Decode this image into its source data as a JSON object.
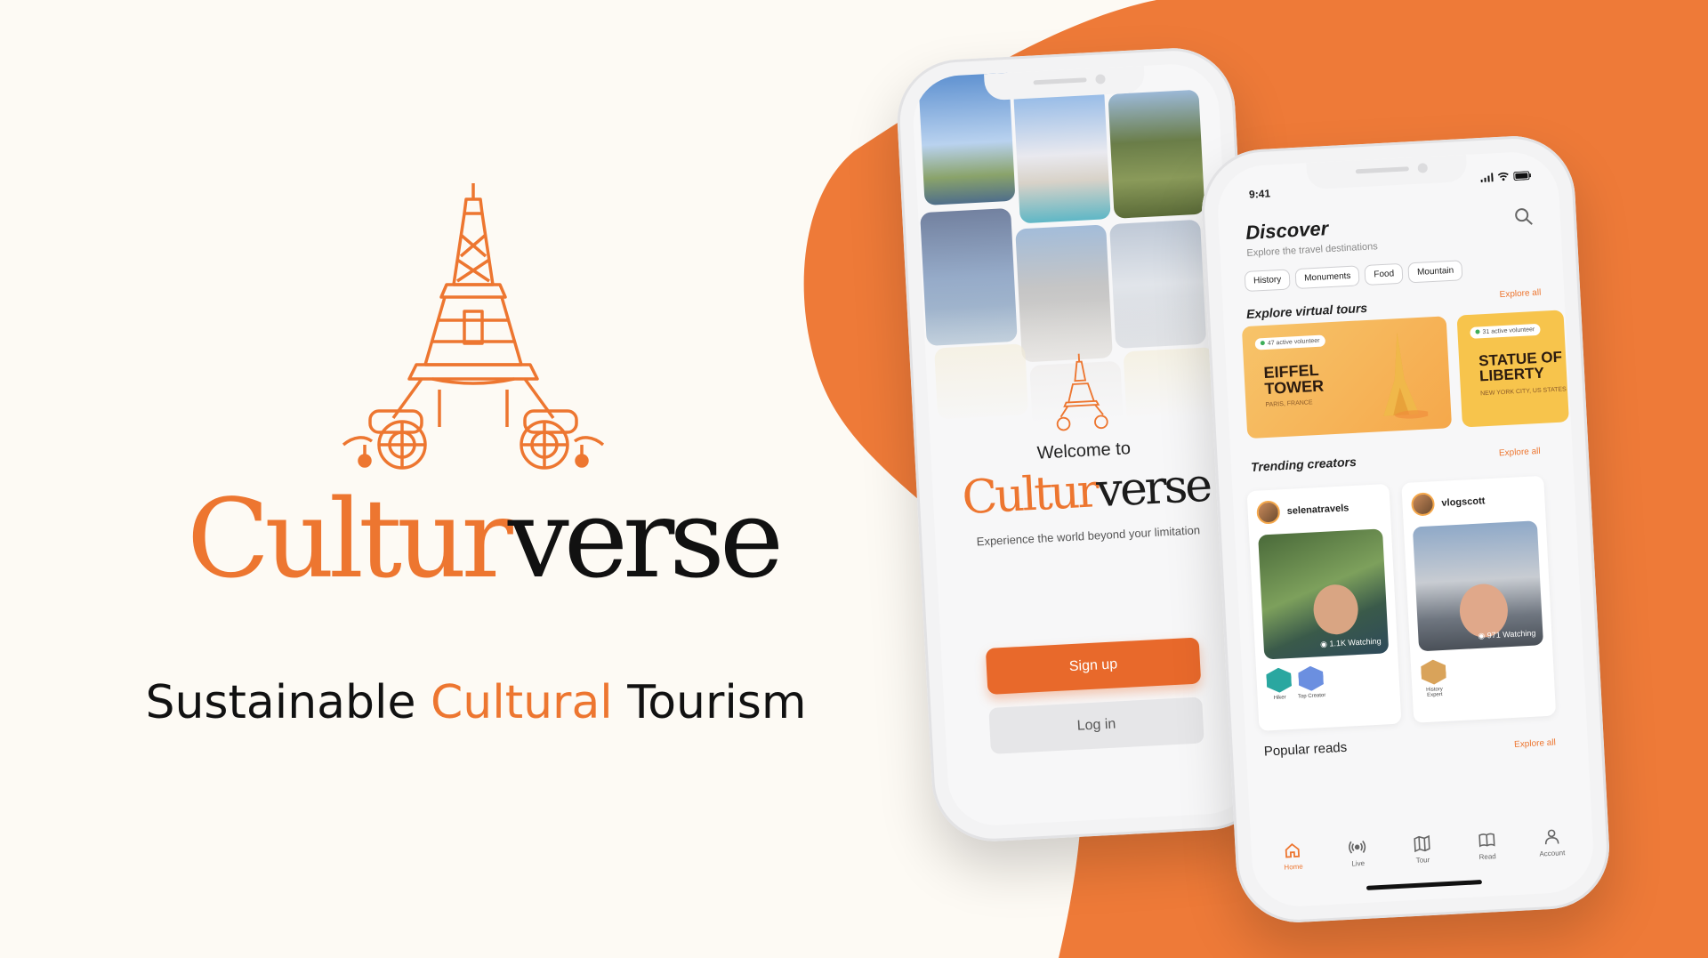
{
  "brand": {
    "name_part1": "Cultur",
    "name_part2": "verse",
    "tagline_part1": "Sustainable ",
    "tagline_highlight": "Cultural",
    "tagline_part2": " Tourism",
    "accent_color": "#ed7630"
  },
  "welcome_screen": {
    "welcome_text": "Welcome to",
    "name_part1": "Cultur",
    "name_part2": "verse",
    "subtitle": "Experience the world beyond your limitation",
    "signup_label": "Sign up",
    "login_label": "Log in"
  },
  "discover_screen": {
    "status_time": "9:41",
    "title": "Discover",
    "subtitle": "Explore the travel destinations",
    "chips": [
      "History",
      "Monuments",
      "Food",
      "Mountain"
    ],
    "virtual_tours_title": "Explore virtual tours",
    "explore_all": "Explore all",
    "tours": [
      {
        "volunteers": "47 active volunteer",
        "name_line1": "EIFFEL",
        "name_line2": "TOWER",
        "location": "PARIS, FRANCE"
      },
      {
        "volunteers": "31 active volunteer",
        "name_line1": "STATUE OF",
        "name_line2": "LIBERTY",
        "location": "NEW YORK CITY, US STATES"
      }
    ],
    "trending_title": "Trending creators",
    "creators": [
      {
        "name": "selenatravels",
        "watching": "1.1K Watching",
        "badges": [
          "Hiker",
          "Top Creator"
        ]
      },
      {
        "name": "vlogscott",
        "watching": "971 Watching",
        "badges": [
          "History Expert"
        ]
      }
    ],
    "popular_reads_title": "Popular reads",
    "nav": [
      {
        "label": "Home",
        "icon": "home-icon"
      },
      {
        "label": "Live",
        "icon": "live-icon"
      },
      {
        "label": "Tour",
        "icon": "map-icon"
      },
      {
        "label": "Read",
        "icon": "book-icon"
      },
      {
        "label": "Account",
        "icon": "user-icon"
      }
    ]
  }
}
